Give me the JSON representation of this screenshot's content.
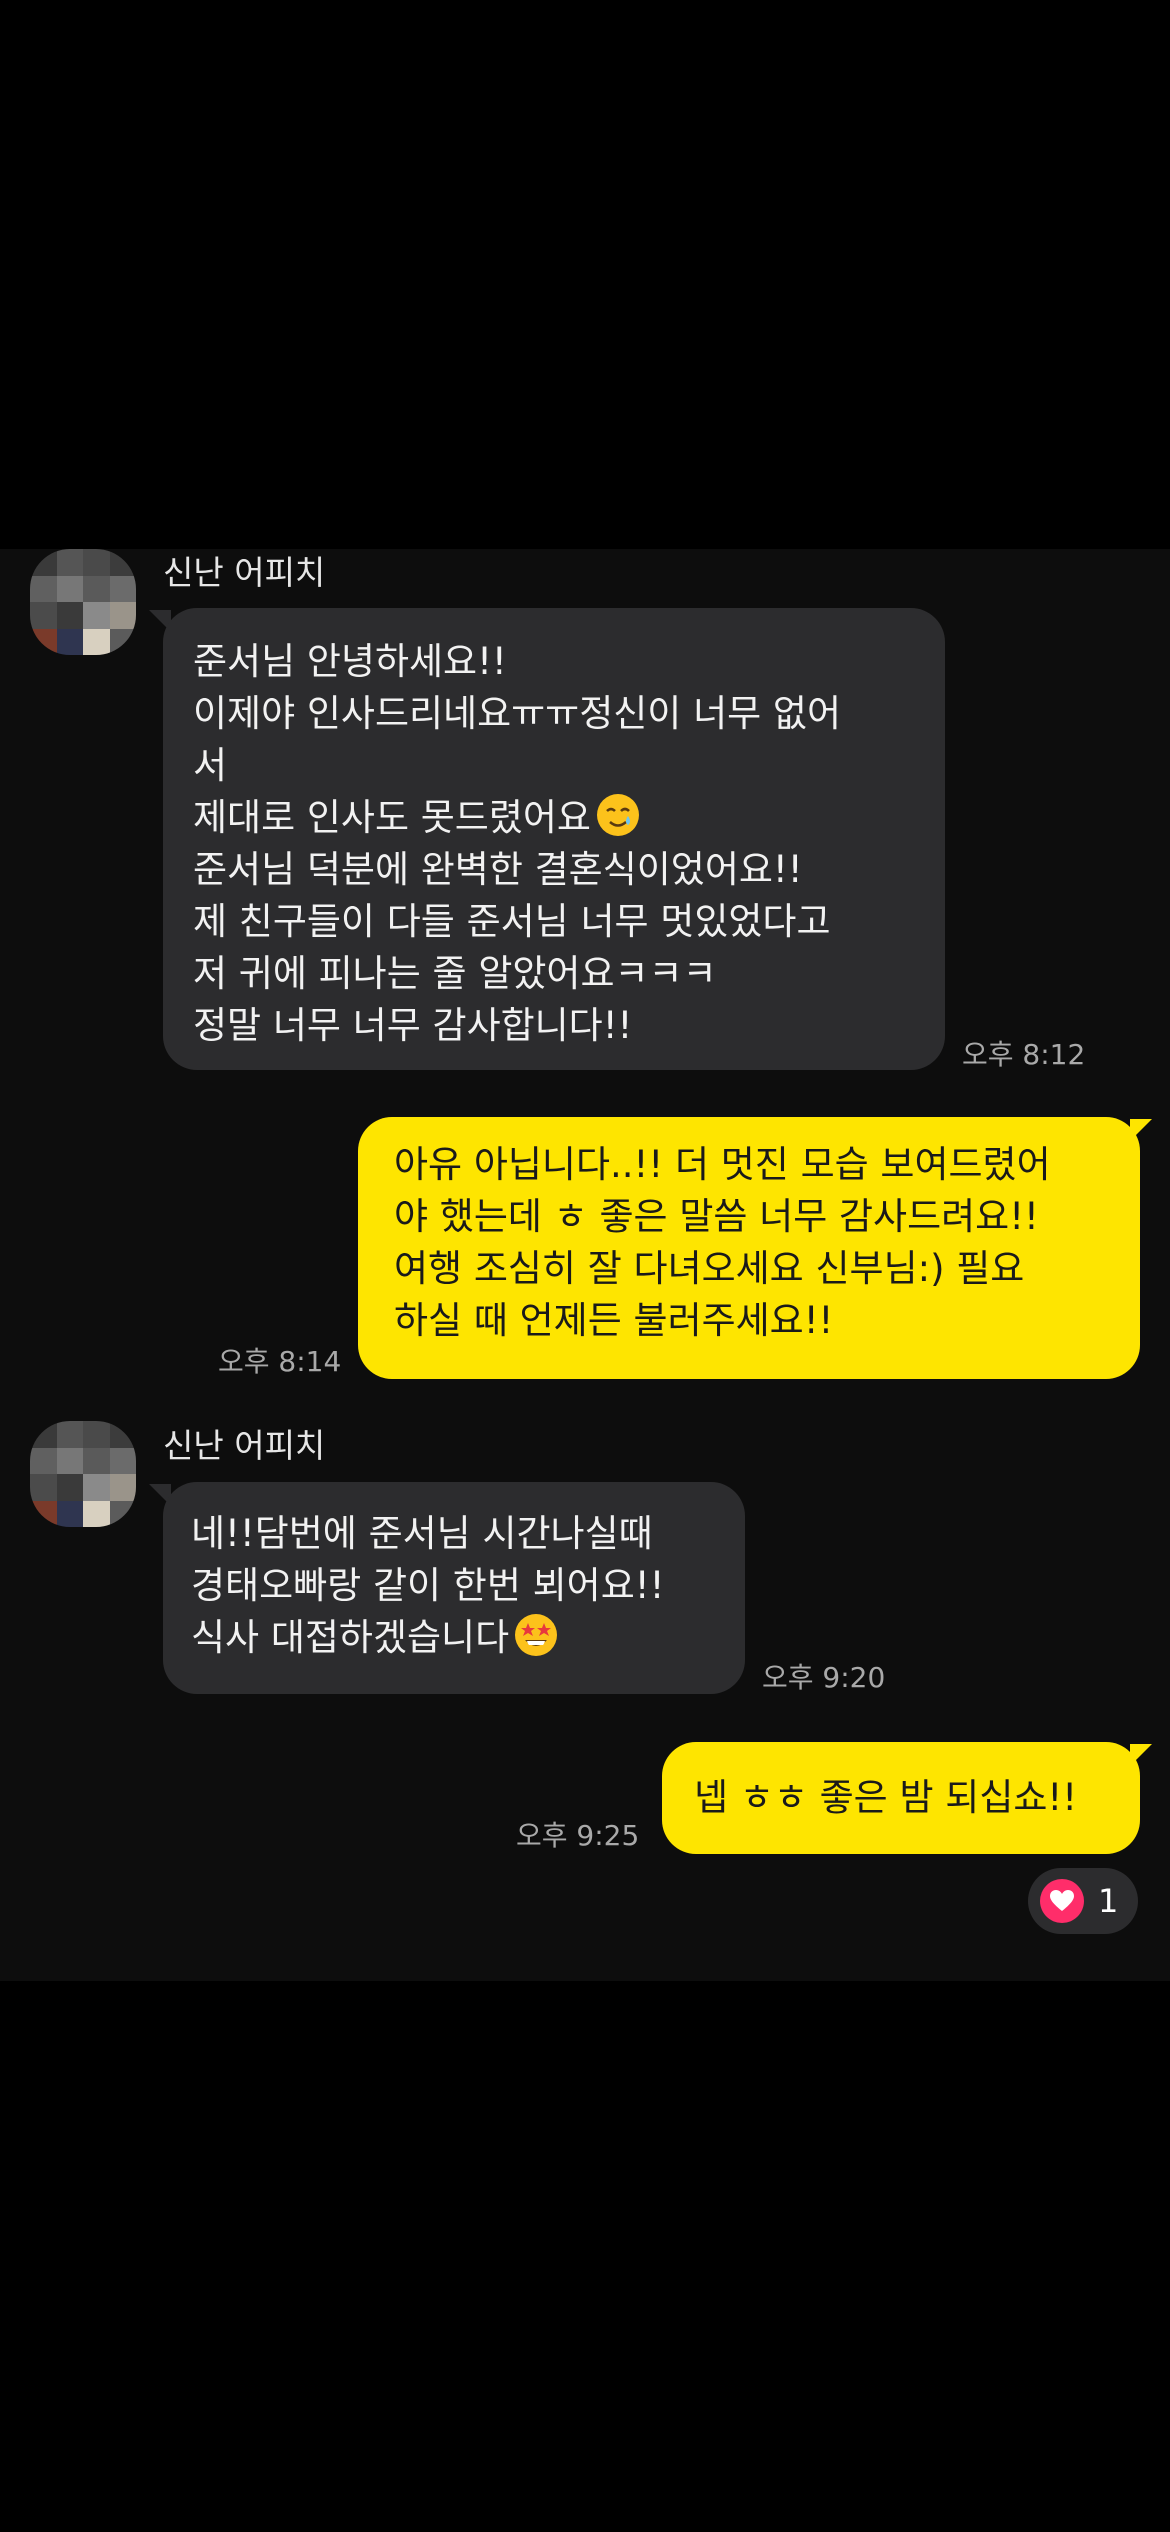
{
  "messages": [
    {
      "sender": "신난 어피치",
      "direction": "incoming",
      "text": "준서님 안녕하세요!!\n이제야 인사드리네요ㅠㅠ정신이 너무 없어\n서\n제대로 인사도 못드렸어요",
      "text_after_emoji": "\n준서님 덕분에 완벽한 결혼식이었어요!!\n제 친구들이 다들 준서님 너무 멋있었다고\n저 귀에 피나는 줄 알았어요ㅋㅋㅋ\n정말 너무 너무 감사합니다!!",
      "emoji": "smiling-face-with-tear",
      "time": "오후 8:12"
    },
    {
      "direction": "outgoing",
      "text": "아유 아닙니다..!! 더 멋진 모습 보여드렸어\n야 했는데 ㅎ 좋은 말씀 너무 감사드려요!!\n여행 조심히 잘 다녀오세요 신부님:) 필요\n하실 때 언제든 불러주세요!!",
      "time": "오후 8:14"
    },
    {
      "sender": "신난 어피치",
      "direction": "incoming",
      "text": "네!!담번에 준서님 시간나실때\n경태오빠랑 같이 한번 뵈어요!!\n식사 대접하겠습니다",
      "emoji": "star-struck",
      "time": "오후 9:20"
    },
    {
      "direction": "outgoing",
      "text": "넵 ㅎㅎ 좋은 밤 되십쇼!!",
      "time": "오후 9:25",
      "reaction": {
        "icon": "heart-icon",
        "count": "1"
      }
    }
  ],
  "colors": {
    "background": "#000000",
    "chat_background": "#0d0d0d",
    "incoming_bubble": "#2c2c2e",
    "outgoing_bubble": "#fee500",
    "timestamp": "#a9a9a9",
    "reaction_heart": "#ff2d6a"
  }
}
